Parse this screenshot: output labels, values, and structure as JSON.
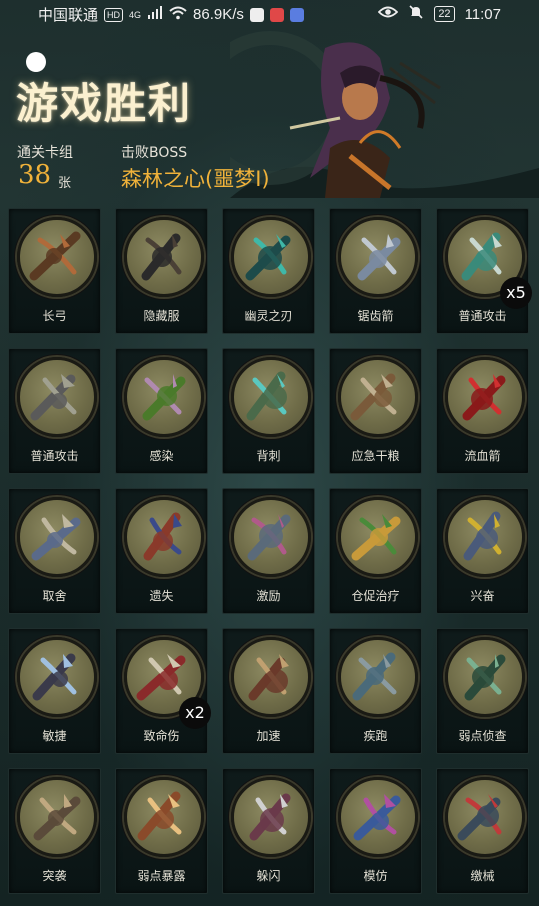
{
  "status_bar": {
    "carrier": "中国联通",
    "net_badge": "HD",
    "net_gen": "4G",
    "speed": "86.9K/s",
    "battery": "22",
    "time": "11:07"
  },
  "header": {
    "title": "游戏胜利",
    "deck_label": "通关卡组",
    "deck_count": "38",
    "deck_unit": "张",
    "boss_label": "击败BOSS",
    "boss_name": "森林之心(噩梦I)"
  },
  "cards": [
    {
      "label": "长弓",
      "icon": "longbow-icon",
      "badge": ""
    },
    {
      "label": "隐藏服",
      "icon": "hooded-cloak-icon",
      "badge": ""
    },
    {
      "label": "幽灵之刃",
      "icon": "ghost-blade-icon",
      "badge": ""
    },
    {
      "label": "锯齿箭",
      "icon": "serrated-arrow-icon",
      "badge": ""
    },
    {
      "label": "普通攻击",
      "icon": "arrow-volley-icon",
      "badge": "x5"
    },
    {
      "label": "普通攻击",
      "icon": "arrow-volley-icon",
      "badge": ""
    },
    {
      "label": "感染",
      "icon": "infection-icon",
      "badge": ""
    },
    {
      "label": "背刺",
      "icon": "backstab-icon",
      "badge": ""
    },
    {
      "label": "应急干粮",
      "icon": "rations-icon",
      "badge": ""
    },
    {
      "label": "流血箭",
      "icon": "bleeding-arrow-icon",
      "badge": ""
    },
    {
      "label": "取舍",
      "icon": "trade-off-icon",
      "badge": ""
    },
    {
      "label": "遗失",
      "icon": "lost-icon",
      "badge": ""
    },
    {
      "label": "激励",
      "icon": "inspire-icon",
      "badge": ""
    },
    {
      "label": "仓促治疗",
      "icon": "hasty-heal-icon",
      "badge": ""
    },
    {
      "label": "兴奋",
      "icon": "excite-icon",
      "badge": ""
    },
    {
      "label": "敏捷",
      "icon": "agility-icon",
      "badge": ""
    },
    {
      "label": "致命伤",
      "icon": "fatal-wound-icon",
      "badge": "x2"
    },
    {
      "label": "加速",
      "icon": "haste-icon",
      "badge": ""
    },
    {
      "label": "疾跑",
      "icon": "sprint-icon",
      "badge": ""
    },
    {
      "label": "弱点侦查",
      "icon": "weakness-scout-icon",
      "badge": ""
    },
    {
      "label": "突袭",
      "icon": "raid-icon",
      "badge": ""
    },
    {
      "label": "弱点暴露",
      "icon": "weakness-expose-icon",
      "badge": ""
    },
    {
      "label": "躲闪",
      "icon": "dodge-icon",
      "badge": ""
    },
    {
      "label": "模仿",
      "icon": "mimic-icon",
      "badge": ""
    },
    {
      "label": "缴械",
      "icon": "disarm-icon",
      "badge": ""
    }
  ],
  "colors": {
    "accent": "#f0b23a",
    "title_glow": "#fbf0cf",
    "disc": "#7d7a52"
  }
}
